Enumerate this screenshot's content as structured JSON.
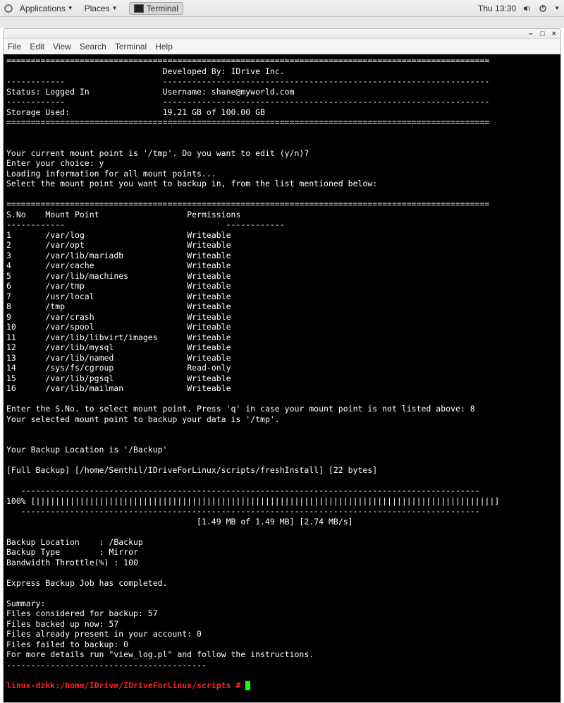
{
  "panel": {
    "applications": "Applications",
    "places": "Places",
    "task_terminal": "Terminal",
    "clock": "Thu 13:30"
  },
  "window_menu": {
    "file": "File",
    "edit": "Edit",
    "view": "View",
    "search": "Search",
    "terminal": "Terminal",
    "help": "Help"
  },
  "hdr": {
    "developed_by": "Developed By: IDrive Inc.",
    "status": "Status: Logged In",
    "username_line": "Username: shane@myworld.com",
    "storage": "Storage Used:",
    "storage_val": "19.21 GB of 100.00 GB"
  },
  "prompts": {
    "mount_q": "Your current mount point is '/tmp'. Do you want to edit (y/n)?",
    "enter_choice": "Enter your choice: y",
    "loading": "Loading information for all mount points...",
    "select_instr": "Select the mount point you want to backup in, from the list mentioned below:"
  },
  "table_hdr": {
    "sno": "S.No",
    "mp": "Mount Point",
    "perm": "Permissions"
  },
  "rows": {
    "r1": {
      "n": "1",
      "p": "/var/log",
      "perm": "Writeable"
    },
    "r2": {
      "n": "2",
      "p": "/var/opt",
      "perm": "Writeable"
    },
    "r3": {
      "n": "3",
      "p": "/var/lib/mariadb",
      "perm": "Writeable"
    },
    "r4": {
      "n": "4",
      "p": "/var/cache",
      "perm": "Writeable"
    },
    "r5": {
      "n": "5",
      "p": "/var/lib/machines",
      "perm": "Writeable"
    },
    "r6": {
      "n": "6",
      "p": "/var/tmp",
      "perm": "Writeable"
    },
    "r7": {
      "n": "7",
      "p": "/usr/local",
      "perm": "Writeable"
    },
    "r8": {
      "n": "8",
      "p": "/tmp",
      "perm": "Writeable"
    },
    "r9": {
      "n": "9",
      "p": "/var/crash",
      "perm": "Writeable"
    },
    "r10": {
      "n": "10",
      "p": "/var/spool",
      "perm": "Writeable"
    },
    "r11": {
      "n": "11",
      "p": "/var/lib/libvirt/images",
      "perm": "Writeable"
    },
    "r12": {
      "n": "12",
      "p": "/var/lib/mysql",
      "perm": "Writeable"
    },
    "r13": {
      "n": "13",
      "p": "/var/lib/named",
      "perm": "Writeable"
    },
    "r14": {
      "n": "14",
      "p": "/sys/fs/cgroup",
      "perm": "Read-only"
    },
    "r15": {
      "n": "15",
      "p": "/var/lib/pgsql",
      "perm": "Writeable"
    },
    "r16": {
      "n": "16",
      "p": "/var/lib/mailman",
      "perm": "Writeable"
    }
  },
  "after": {
    "enter_sno": "Enter the S.No. to select mount point. Press 'q' in case your mount point is not listed above: 8",
    "selected": "Your selected mount point to backup your data is '/tmp'.",
    "backup_loc": "Your Backup Location is '/Backup'",
    "full_backup": "[Full Backup] [/home/Senthil/IDriveForLinux/scripts/freshInstall] [22 bytes]",
    "progress_pct": "100%",
    "progress_stats": "[1.49 MB of 1.49 MB] [2.74 MB/s]",
    "bl": "Backup Location    : /Backup",
    "bt": "Backup Type        : Mirror",
    "bw": "Bandwidth Throttle(%) : 100",
    "done": "Express Backup Job has completed.",
    "summary": "Summary:",
    "s1": "Files considered for backup: 57",
    "s2": "Files backed up now: 57",
    "s3": "Files already present in your account: 0",
    "s4": "Files failed to backup: 0",
    "s5": "For more details run \"view_log.pl\" and follow the instructions."
  },
  "shell": {
    "prompt": "linux-dzkk:/home/IDrive/IDriveForLinux/scripts #"
  },
  "bars": {
    "eq_long": "===================================================================================================",
    "dash12": "------------",
    "dash_long": "-------------------------------------------------------------------",
    "dash_short": "-----------------------------------------",
    "prog_dash": "   ----------------------------------------------------------------------------------------------",
    "prog_fill": " [||||||||||||||||||||||||||||||||||||||||||||||||||||||||||||||||||||||||||||||||||||||||||||||]"
  }
}
